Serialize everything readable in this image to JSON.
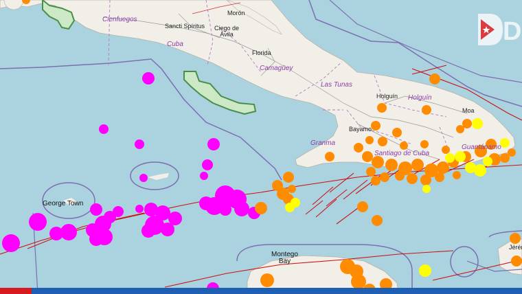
{
  "map": {
    "labels": {
      "cienfuegos": "Cienfuegos",
      "sancti_spiritus": "Sancti Spíritus",
      "moron": "Morón",
      "ciego_de_avila": "Ciego de\nÁvila",
      "cuba": "Cuba",
      "florida": "Florida",
      "camaguey": "Camagüey",
      "las_tunas": "Las Tunas",
      "holguin_city": "Holguín",
      "holguin_prov": "Holguín",
      "moa": "Moa",
      "bayamo": "Bayamo",
      "granma": "Granma",
      "santiago": "Santiago de Cuba",
      "guantanamo": "Guantánamo",
      "george_town": "George Town",
      "montego_bay": "Montego\nBay",
      "jeremie": "Jérém"
    },
    "colors": {
      "sea": "#aad3df",
      "land": "#f2efe9",
      "magenta_quake": "#ff00ff",
      "orange_quake": "#ff8c00",
      "yellow_quake": "#ffff00",
      "fault_line": "#cc1111",
      "boundary": "#7b6fb0"
    },
    "logo_text": "DC"
  }
}
